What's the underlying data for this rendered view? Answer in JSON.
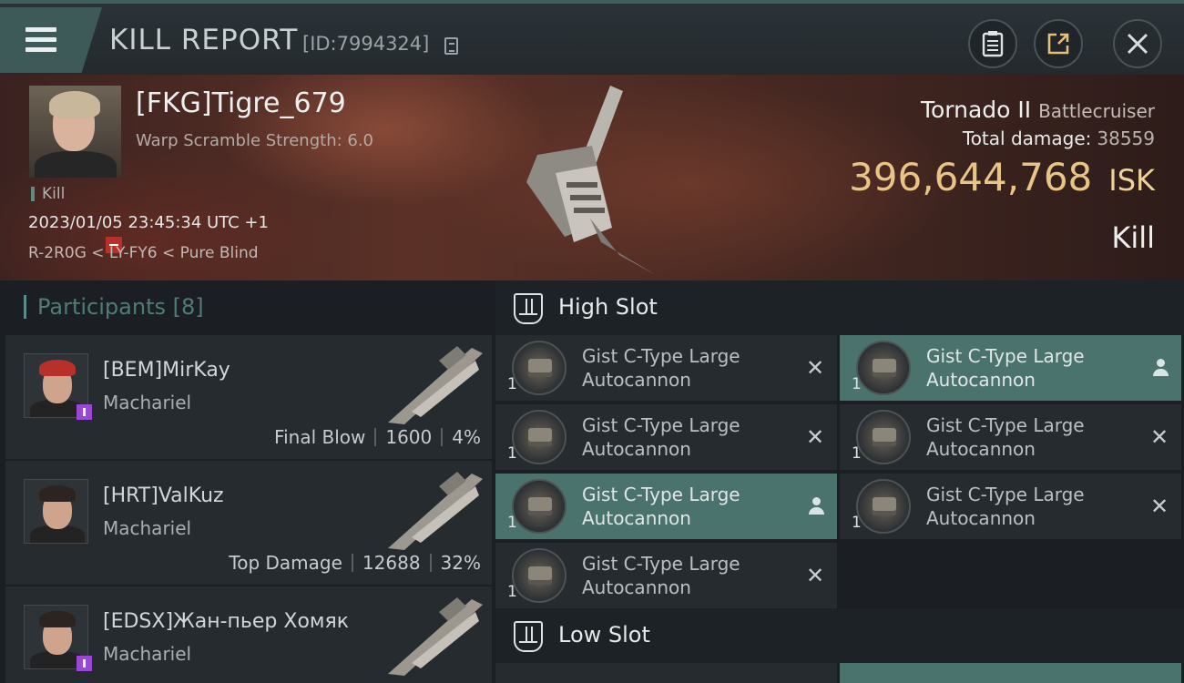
{
  "header": {
    "title": "KILL REPORT",
    "report_id": "[ID:7994324]",
    "icons": [
      "menu-icon",
      "copy-icon",
      "clipboard-icon",
      "share-icon",
      "close-icon"
    ]
  },
  "victim": {
    "name": "[FKG]Tigre_679",
    "warp_scramble": "Warp Scramble Strength: 6.0",
    "kill_tag": "Kill",
    "datetime": "2023/01/05 23:45:34 UTC +1",
    "location": "R-2R0G < LY-FY6 < Pure Blind",
    "ship_name": "Tornado II",
    "ship_class": "Battlecruiser",
    "total_damage_label": "Total damage:",
    "total_damage": "38559",
    "isk_value": "396,644,768",
    "isk_unit": "ISK",
    "result": "Kill"
  },
  "participants": {
    "label": "Participants",
    "count": "[8]",
    "rows": [
      {
        "name": "[BEM]MirKay",
        "ship": "Machariel",
        "stat_label": "Final Blow",
        "damage": "1600",
        "percent": "4%"
      },
      {
        "name": "[HRT]ValKuz",
        "ship": "Machariel",
        "stat_label": "Top Damage",
        "damage": "12688",
        "percent": "32%"
      },
      {
        "name": "[EDSX]Жан-пьер Хомяк",
        "ship": "Machariel"
      }
    ]
  },
  "slots": {
    "high_title": "High Slot",
    "low_title": "Low Slot",
    "high_modules": [
      {
        "qty": "1",
        "line1": "Gist C-Type Large",
        "line2": "Autocannon"
      },
      {
        "qty": "1",
        "line1": "Gist C-Type Large",
        "line2": "Autocannon"
      },
      {
        "qty": "1",
        "line1": "Gist C-Type Large",
        "line2": "Autocannon"
      },
      {
        "qty": "1",
        "line1": "Gist C-Type Large",
        "line2": "Autocannon"
      },
      {
        "qty": "1",
        "line1": "Gist C-Type Large",
        "line2": "Autocannon"
      },
      {
        "qty": "1",
        "line1": "Gist C-Type Large",
        "line2": "Autocannon"
      },
      {
        "qty": "1",
        "line1": "Gist C-Type Large",
        "line2": "Autocannon"
      }
    ]
  },
  "colors": {
    "accent": "#4a736e",
    "isk": "#e9c585",
    "danger": "#b8302a",
    "badge": "#9a47d4"
  }
}
